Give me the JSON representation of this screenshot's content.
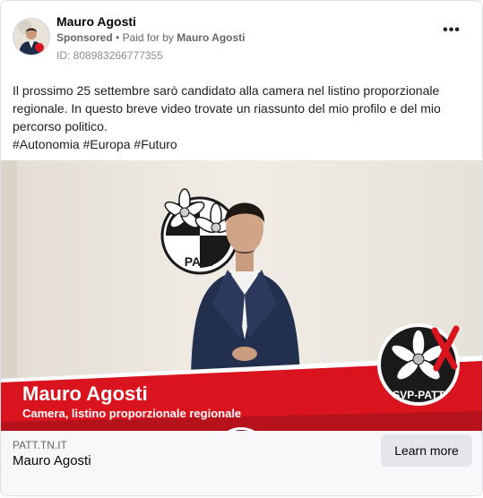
{
  "header": {
    "page_name": "Mauro Agosti",
    "sponsored_label": "Sponsored",
    "separator": "•",
    "paid_for_prefix": "Paid for by",
    "paid_for_name": "Mauro Agosti",
    "ad_id": "ID: 808983266777355",
    "more_label": "•••"
  },
  "post": {
    "text": "Il prossimo 25 settembre sarò candidato alla camera nel listino proporzionale regionale. In questo breve video trovate un riassunto del mio profilo e del mio percorso politico.",
    "hashtags": "#Autonomia #Europa #Futuro"
  },
  "video": {
    "logo_label": "PATT",
    "banner_name": "Mauro Agosti",
    "banner_subtitle": "Camera, listino proporzionale regionale",
    "corner_logo_label": "SVP-PATT",
    "colors": {
      "banner_red": "#d9141f",
      "banner_dark": "#b5121c"
    }
  },
  "footer": {
    "domain": "PATT.TN.IT",
    "title": "Mauro Agosti",
    "cta_label": "Learn more"
  }
}
